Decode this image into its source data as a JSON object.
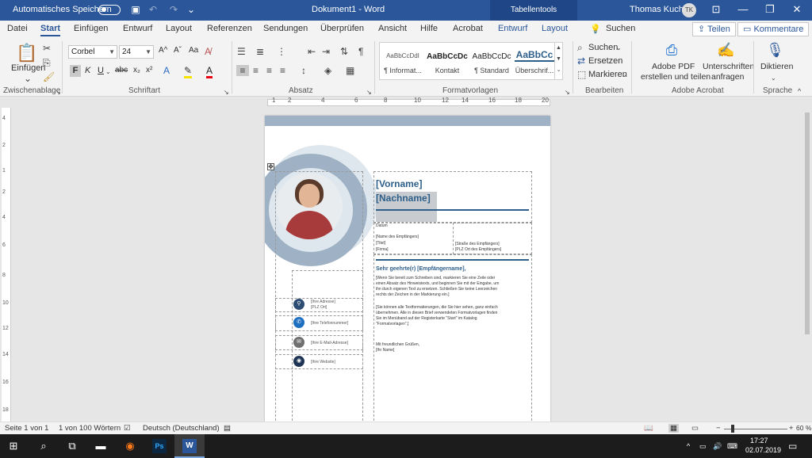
{
  "titlebar": {
    "autosave": "Automatisches Speichern",
    "doc_title": "Dokument1 - Word",
    "context_tools": "Tabellentools",
    "user": "Thomas Kuch",
    "user_initials": "TK"
  },
  "tabs": {
    "items": [
      "Datei",
      "Start",
      "Einfügen",
      "Entwurf",
      "Layout",
      "Referenzen",
      "Sendungen",
      "Überprüfen",
      "Ansicht",
      "Hilfe",
      "Acrobat"
    ],
    "ctx_design": "Entwurf",
    "ctx_layout": "Layout",
    "search": "Suchen",
    "share": "Teilen",
    "comments": "Kommentare"
  },
  "ribbon": {
    "clipboard": {
      "paste": "Einfügen",
      "label": "Zwischenablage"
    },
    "font": {
      "name": "Corbel",
      "size": "24",
      "label": "Schriftart",
      "bold": "F",
      "italic": "K",
      "underline": "U",
      "strike": "abc",
      "sub": "x₂",
      "sup": "x²",
      "grow": "A^",
      "shrink": "Aˇ",
      "case": "Aa"
    },
    "paragraph": {
      "label": "Absatz"
    },
    "styles": {
      "label": "Formatvorlagen",
      "items": [
        {
          "preview": "AaBbCcDdI",
          "name": "¶ Informat..."
        },
        {
          "preview": "AaBbCcDc",
          "name": "Kontakt"
        },
        {
          "preview": "AaBbCcDc",
          "name": "¶ Standard"
        },
        {
          "preview": "AaBbCc",
          "name": "Überschrif..."
        }
      ]
    },
    "editing": {
      "label": "Bearbeiten",
      "find": "Suchen",
      "replace": "Ersetzen",
      "select": "Markieren"
    },
    "acrobat": {
      "label": "Adobe Acrobat",
      "pdf1": "Adobe PDF",
      "pdf2": "erstellen und teilen",
      "sign1": "Unterschriften",
      "sign2": "anfragen"
    },
    "speech": {
      "label": "Sprache",
      "dictate": "Diktieren"
    }
  },
  "ruler": {
    "h": [
      "1",
      "2",
      "4",
      "6",
      "8",
      "10",
      "12",
      "14",
      "16",
      "18",
      "20"
    ],
    "v": [
      "4",
      "2",
      "1",
      "2",
      "4",
      "6",
      "8",
      "10",
      "12",
      "14",
      "16",
      "18"
    ]
  },
  "document": {
    "first_name": "[Vorname]",
    "last_name": "[Nachname]",
    "date": "Datum",
    "recipient": [
      "[Name des Empfängers]",
      "[Titel]",
      "[Firma]"
    ],
    "recipient_address": [
      "[Straße des Empfängers]",
      "[PLZ Ort des Empfängers]"
    ],
    "salutation": "Sehr geehrte(r) [Empfängername],",
    "body1": [
      "[Wenn Sie bereit zum Schreiben sind, markieren Sie eine Zeile oder",
      "einen Absatz des Hinweistexts, und beginnen Sie mit der Eingabe, um",
      "ihn durch eigenen Text zu ersetzen. Schließen Sie keine Leerzeichen",
      "rechts der Zeichen in der Markierung ein.]"
    ],
    "body2": [
      "[Sie können alle Textformatierungen, die Sie hier sehen, ganz einfach",
      "übernehmen. Alle in diesen Brief verwendeten Formatvorlagen finden",
      "Sie im Menüband auf der Registerkarte \"Start\" im Katalog",
      "\"Formatvorlagen\".]"
    ],
    "closing": "Mit freundlichen Grüßen,",
    "signature": "[Ihr Name]",
    "contacts": [
      {
        "icon": "location-icon",
        "lines": [
          "[Ihre Adresse]",
          "[PLZ Ort]"
        ]
      },
      {
        "icon": "phone-icon",
        "lines": [
          "[Ihre Telefonnummer]"
        ]
      },
      {
        "icon": "email-icon",
        "lines": [
          "[Ihre E-Mail-Adresse]"
        ]
      },
      {
        "icon": "website-icon",
        "lines": [
          "[Ihre Website]"
        ]
      }
    ],
    "accent": "#2e5f8a",
    "band": "#9eb1c5"
  },
  "status": {
    "page": "Seite 1 von 1",
    "words": "1 von 100 Wörtern",
    "language": "Deutsch (Deutschland)",
    "zoom": "60 %"
  },
  "taskbar": {
    "time": "17:27",
    "date": "02.07.2019"
  }
}
